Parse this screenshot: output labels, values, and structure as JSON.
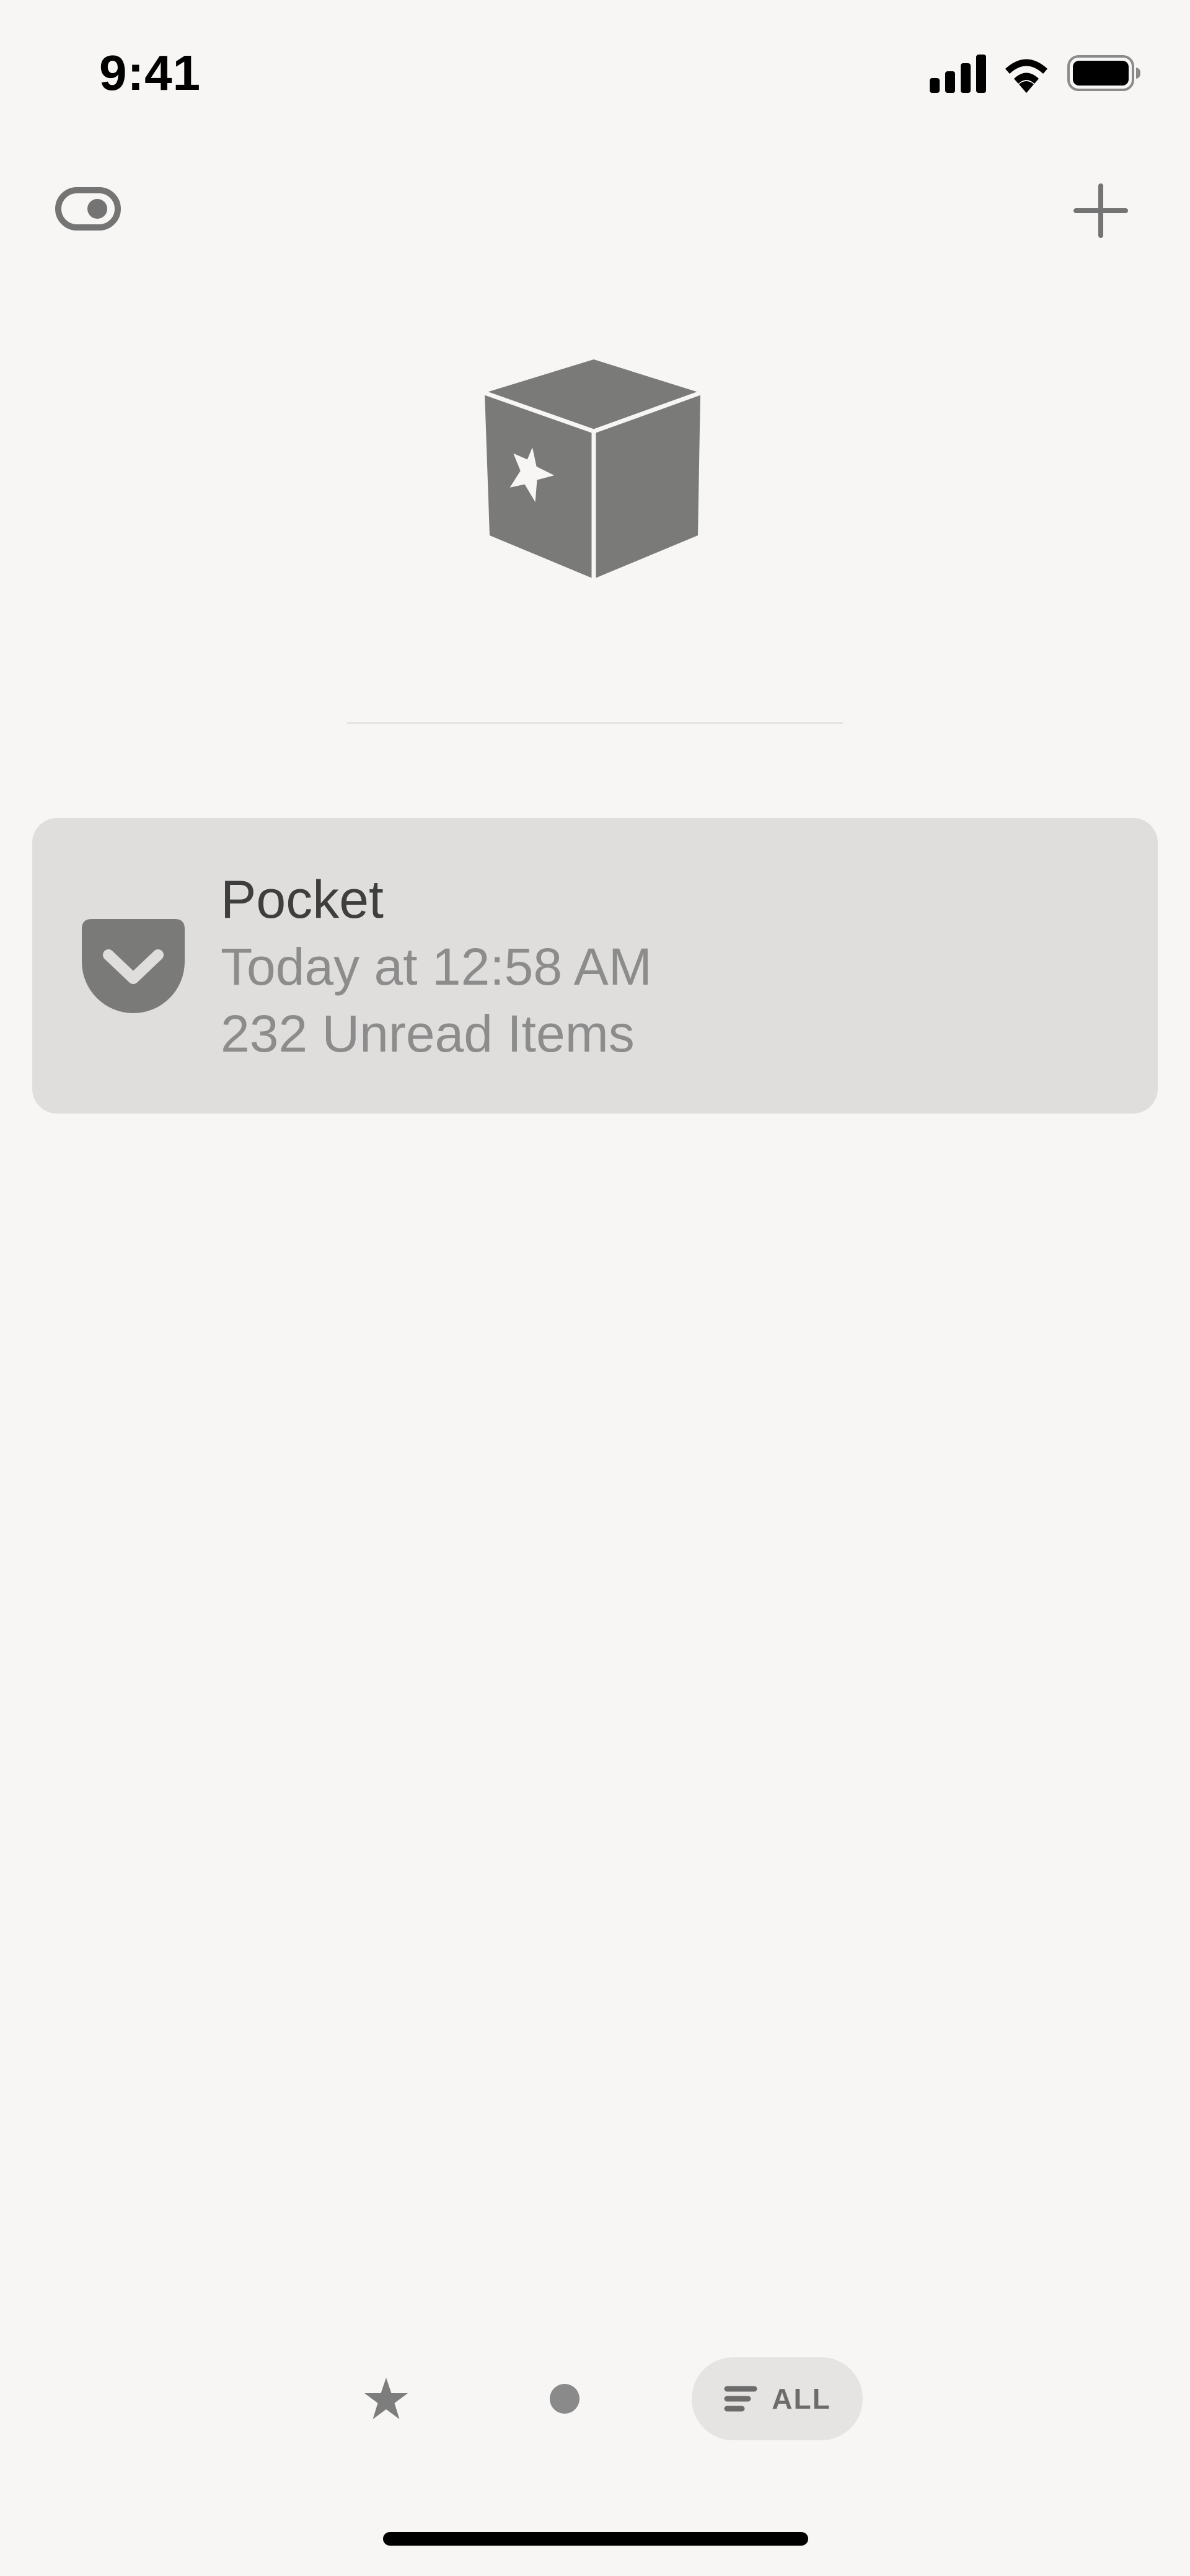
{
  "status_bar": {
    "time": "9:41",
    "icons": [
      "cellular-signal-icon",
      "wifi-icon",
      "battery-icon"
    ]
  },
  "header": {
    "left_icon": "toggle-icon",
    "right_icon": "add-icon"
  },
  "hero": {
    "icon": "cube-star-icon"
  },
  "accounts": [
    {
      "icon": "pocket-icon",
      "name": "Pocket",
      "updated": "Today at 12:58 AM",
      "unread": "232 Unread Items"
    }
  ],
  "filter_bar": {
    "starred_icon": "star-icon",
    "unread_icon": "unread-dot-icon",
    "all_icon": "list-icon",
    "all_label": "ALL",
    "selected": "ALL"
  },
  "colors": {
    "background": "#f7f6f4",
    "card": "#dfdedc",
    "icon_gray": "#777777",
    "text_primary": "#3e3e3e",
    "text_secondary": "#8c8c8c",
    "pill": "#e5e4e2"
  }
}
